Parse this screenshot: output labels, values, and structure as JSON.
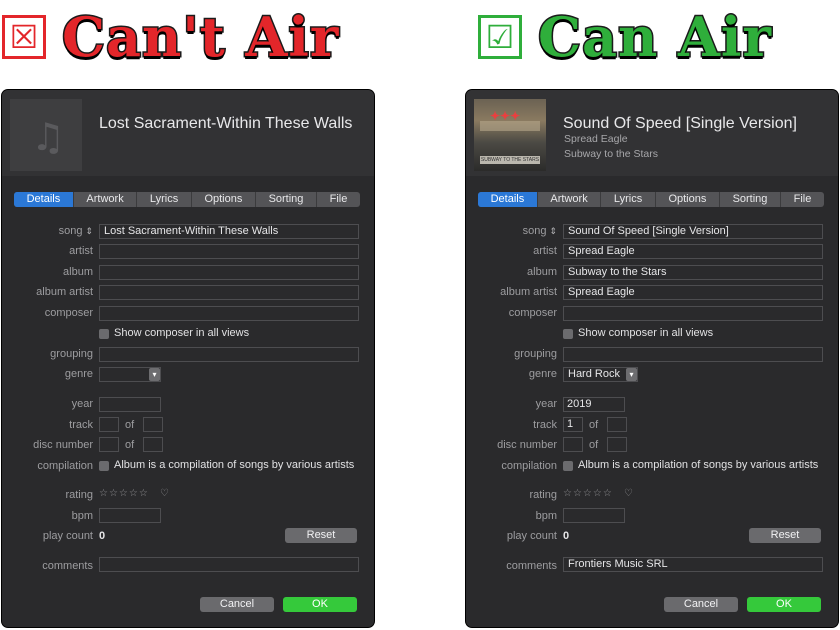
{
  "left_heading": {
    "mark": "☒",
    "text": "Can't Air",
    "color": "#e3262a"
  },
  "right_heading": {
    "mark": "☑",
    "text": "Can Air",
    "color": "#2fae3b"
  },
  "tabs": [
    "Details",
    "Artwork",
    "Lyrics",
    "Options",
    "Sorting",
    "File"
  ],
  "labels": {
    "song": "song",
    "artist": "artist",
    "album": "album",
    "album_artist": "album artist",
    "composer": "composer",
    "show_composer": "Show composer in all views",
    "grouping": "grouping",
    "genre": "genre",
    "year": "year",
    "track": "track",
    "disc_number": "disc number",
    "of": "of",
    "compilation": "compilation",
    "compilation_text": "Album is a compilation of songs by various artists",
    "rating": "rating",
    "bpm": "bpm",
    "play_count": "play count",
    "comments": "comments"
  },
  "rating_stars": "☆☆☆☆☆",
  "heart_icon": "♡",
  "reset_label": "Reset",
  "cancel_label": "Cancel",
  "ok_label": "OK",
  "left": {
    "title": "Lost Sacrament-Within These Walls",
    "song": "Lost Sacrament-Within These Walls",
    "artist": "",
    "album": "",
    "album_artist": "",
    "composer": "",
    "grouping": "",
    "genre": "",
    "year": "",
    "track": "",
    "track_of": "",
    "disc": "",
    "disc_of": "",
    "bpm": "",
    "play_count": "0",
    "comments": ""
  },
  "right": {
    "title": "Sound Of Speed [Single Version]",
    "subtitle_artist": "Spread Eagle",
    "subtitle_album": "Subway to the Stars",
    "song": "Sound Of Speed [Single Version]",
    "artist": "Spread Eagle",
    "album": "Subway to the Stars",
    "album_artist": "Spread Eagle",
    "composer": "",
    "grouping": "",
    "genre": "Hard Rock",
    "year": "2019",
    "track": "1",
    "track_of": "",
    "disc": "",
    "disc_of": "",
    "bpm": "",
    "play_count": "0",
    "comments": "Frontiers Music SRL",
    "cover_text": "SUBWAY TO THE STARS"
  }
}
